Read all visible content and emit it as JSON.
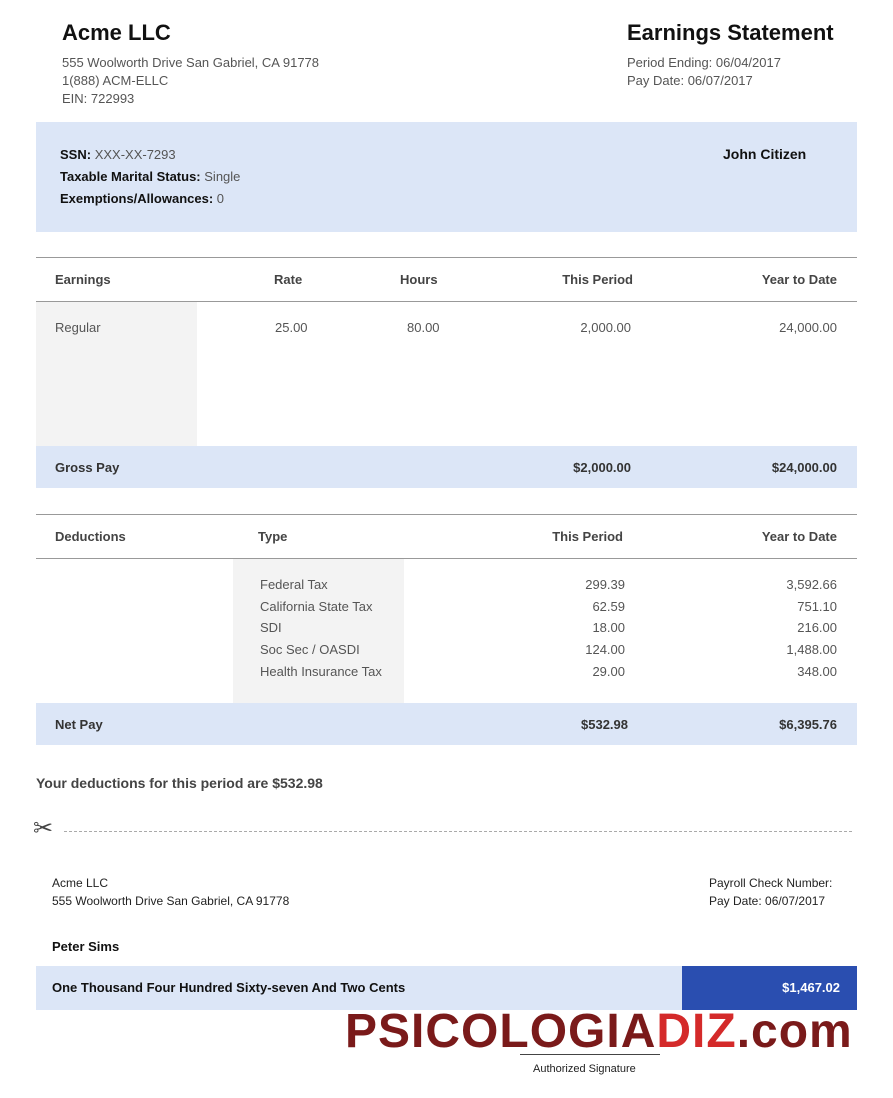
{
  "company": {
    "name": "Acme LLC",
    "address": "555 Woolworth Drive San Gabriel, CA 91778",
    "phone": "1(888) ACM-ELLC",
    "ein": "EIN: 722993"
  },
  "statement": {
    "title": "Earnings Statement",
    "period_ending": "Period Ending: 06/04/2017",
    "pay_date": "Pay Date: 06/07/2017"
  },
  "employee": {
    "ssn_label": "SSN:",
    "ssn_value": "XXX-XX-7293",
    "marital_label": "Taxable Marital Status:",
    "marital_value": "Single",
    "exemptions_label": "Exemptions/Allowances:",
    "exemptions_value": "0",
    "name": "John Citizen"
  },
  "earnings": {
    "headers": [
      "Earnings",
      "Rate",
      "Hours",
      "This Period",
      "Year to Date"
    ],
    "rows": [
      {
        "name": "Regular",
        "rate": "25.00",
        "hours": "80.00",
        "this_period": "2,000.00",
        "ytd": "24,000.00"
      }
    ],
    "gross_label": "Gross Pay",
    "gross_period": "$2,000.00",
    "gross_ytd": "$24,000.00"
  },
  "deductions": {
    "headers": [
      "Deductions",
      "Type",
      "This Period",
      "Year to Date"
    ],
    "rows": [
      {
        "type": "Federal Tax",
        "this_period": "299.39",
        "ytd": "3,592.66"
      },
      {
        "type": "California State Tax",
        "this_period": "62.59",
        "ytd": "751.10"
      },
      {
        "type": "SDI",
        "this_period": "18.00",
        "ytd": "216.00"
      },
      {
        "type": "Soc Sec / OASDI",
        "this_period": "124.00",
        "ytd": "1,488.00"
      },
      {
        "type": "Health Insurance Tax",
        "this_period": "29.00",
        "ytd": "348.00"
      }
    ],
    "net_label": "Net Pay",
    "net_period": "$532.98",
    "net_ytd": "$6,395.76"
  },
  "summary": "Your deductions for this period are $532.98",
  "scissors_icon": "✂",
  "check": {
    "company": "Acme LLC",
    "address": "555 Woolworth Drive San Gabriel, CA 91778",
    "check_number_label": "Payroll Check Number:",
    "pay_date": "Pay Date: 06/07/2017",
    "payee": "Peter Sims",
    "amount_words": "One Thousand Four Hundred Sixty-seven And Two Cents",
    "amount": "$1,467.02",
    "signature_label": "Authorized Signature"
  },
  "watermark": {
    "part1": "PSICOLOGIA",
    "part2": "DIZ",
    "part3": ".com"
  }
}
